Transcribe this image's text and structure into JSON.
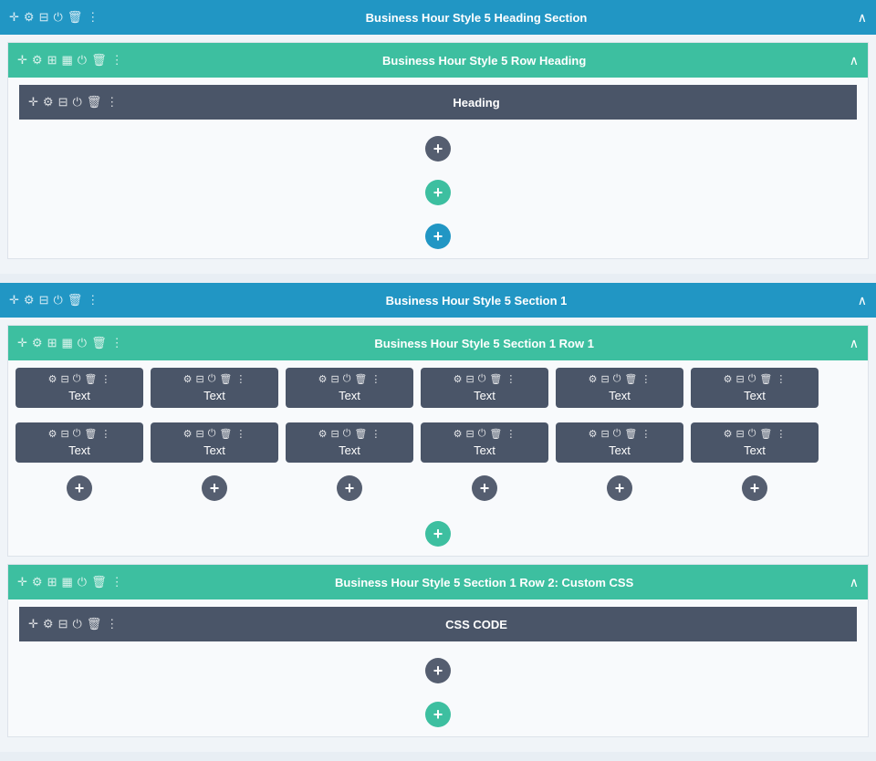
{
  "sections": [
    {
      "id": "heading-section",
      "type": "blue",
      "title": "Business Hour Style 5 Heading Section",
      "rows": [
        {
          "id": "heading-row",
          "type": "teal",
          "title": "Business Hour Style 5 Row Heading",
          "inner_blocks": [
            {
              "label": "Heading"
            }
          ],
          "inner_plus": [
            "dark"
          ],
          "row_plus": [
            "teal",
            "blue"
          ]
        }
      ]
    },
    {
      "id": "section-1",
      "type": "blue",
      "title": "Business Hour Style 5 Section 1",
      "rows": [
        {
          "id": "section-1-row-1",
          "type": "teal",
          "title": "Business Hour Style 5 Section 1 Row 1",
          "columns": 6,
          "text_rows": [
            [
              "Text",
              "Text",
              "Text",
              "Text",
              "Text",
              "Text"
            ],
            [
              "Text",
              "Text",
              "Text",
              "Text",
              "Text",
              "Text"
            ]
          ],
          "row_plus": [
            "teal"
          ]
        },
        {
          "id": "section-1-row-2",
          "type": "teal",
          "title": "Business Hour Style 5 Section 1 Row 2: Custom CSS",
          "inner_blocks": [
            {
              "label": "CSS CODE"
            }
          ],
          "inner_plus": [
            "dark",
            "teal"
          ],
          "row_plus": []
        }
      ]
    }
  ],
  "icons": {
    "gear": "⚙",
    "layers": "⊞",
    "power": "⏻",
    "trash": "🗑",
    "dots": "⋮",
    "plus": "+",
    "chevron_up": "∧",
    "move": "⊕"
  }
}
